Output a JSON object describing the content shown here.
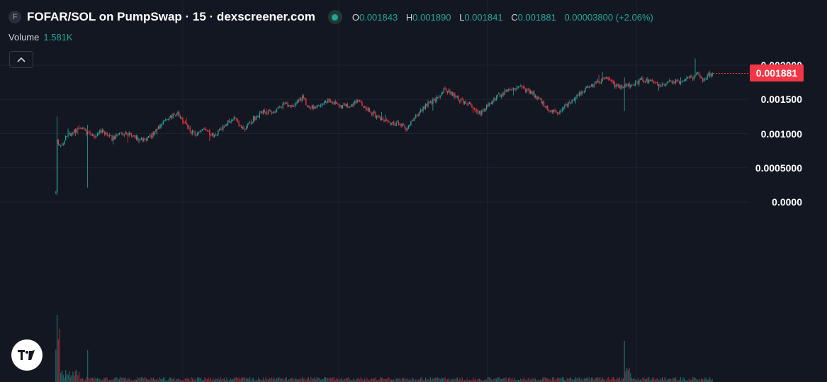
{
  "header": {
    "symbol_icon": "F",
    "title": "FOFAR/SOL on PumpSwap · 15 · dexscreener.com",
    "status": "live-dot-icon",
    "ohlc": {
      "o_label": "O",
      "o_value": "0.001843",
      "h_label": "H",
      "h_value": "0.001890",
      "l_label": "L",
      "l_value": "0.001841",
      "c_label": "C",
      "c_value": "0.001881",
      "change": "0.00003800 (+2.06%)"
    }
  },
  "volume": {
    "label": "Volume",
    "value": "1.581K"
  },
  "controls": {
    "collapse_icon": "chevron-up-icon",
    "logo": "tradingview-logo-icon"
  },
  "price_axis": {
    "ticks": [
      "0.002000",
      "0.001500",
      "0.001000",
      "0.0005000",
      "0.0000"
    ],
    "last_price": "0.001881"
  },
  "colors": {
    "background": "#131722",
    "up": "#26a69a",
    "down": "#f23645",
    "grid": "#1f2330",
    "text": "#d1d4dc"
  },
  "chart_data": {
    "type": "candlestick",
    "title": "FOFAR/SOL on PumpSwap · 15 · dexscreener.com",
    "interval": "15",
    "ylim": [
      -0.0003,
      0.0022
    ],
    "y_ticks": [
      0.002,
      0.0015,
      0.001,
      0.0005,
      0.0
    ],
    "grid": true,
    "last_price": 0.001881,
    "anchors": [
      [
        0,
        0.00015
      ],
      [
        1,
        0.0009
      ],
      [
        4,
        0.00082
      ],
      [
        8,
        0.00095
      ],
      [
        14,
        0.00103
      ],
      [
        20,
        0.00108
      ],
      [
        30,
        0.00095
      ],
      [
        38,
        0.00104
      ],
      [
        46,
        0.00092
      ],
      [
        52,
        0.00102
      ],
      [
        60,
        0.00098
      ],
      [
        68,
        0.00092
      ],
      [
        76,
        0.00094
      ],
      [
        84,
        0.00108
      ],
      [
        92,
        0.00122
      ],
      [
        100,
        0.0013
      ],
      [
        106,
        0.00112
      ],
      [
        114,
        0.00098
      ],
      [
        122,
        0.00105
      ],
      [
        130,
        0.00097
      ],
      [
        138,
        0.00112
      ],
      [
        146,
        0.00125
      ],
      [
        154,
        0.00107
      ],
      [
        162,
        0.00122
      ],
      [
        170,
        0.00132
      ],
      [
        178,
        0.0013
      ],
      [
        186,
        0.00143
      ],
      [
        194,
        0.0014
      ],
      [
        202,
        0.00152
      ],
      [
        208,
        0.00137
      ],
      [
        216,
        0.00143
      ],
      [
        224,
        0.0015
      ],
      [
        232,
        0.0014
      ],
      [
        240,
        0.00141
      ],
      [
        248,
        0.00147
      ],
      [
        256,
        0.00135
      ],
      [
        264,
        0.00122
      ],
      [
        272,
        0.00117
      ],
      [
        280,
        0.00114
      ],
      [
        288,
        0.00107
      ],
      [
        296,
        0.00128
      ],
      [
        304,
        0.00142
      ],
      [
        312,
        0.0015
      ],
      [
        318,
        0.00165
      ],
      [
        324,
        0.00158
      ],
      [
        332,
        0.00148
      ],
      [
        340,
        0.00142
      ],
      [
        348,
        0.00128
      ],
      [
        356,
        0.00145
      ],
      [
        364,
        0.00157
      ],
      [
        372,
        0.00165
      ],
      [
        380,
        0.00167
      ],
      [
        388,
        0.00162
      ],
      [
        396,
        0.0015
      ],
      [
        404,
        0.00135
      ],
      [
        412,
        0.0013
      ],
      [
        420,
        0.00145
      ],
      [
        428,
        0.00158
      ],
      [
        436,
        0.00167
      ],
      [
        444,
        0.00175
      ],
      [
        452,
        0.00182
      ],
      [
        458,
        0.0017
      ],
      [
        464,
        0.00168
      ],
      [
        472,
        0.00172
      ],
      [
        480,
        0.00178
      ],
      [
        488,
        0.00176
      ],
      [
        496,
        0.0017
      ],
      [
        504,
        0.00177
      ],
      [
        512,
        0.00175
      ],
      [
        518,
        0.00182
      ],
      [
        522,
        0.0018
      ],
      [
        526,
        0.0019
      ],
      [
        530,
        0.00178
      ],
      [
        534,
        0.00186
      ],
      [
        538,
        0.00188
      ]
    ]
  }
}
